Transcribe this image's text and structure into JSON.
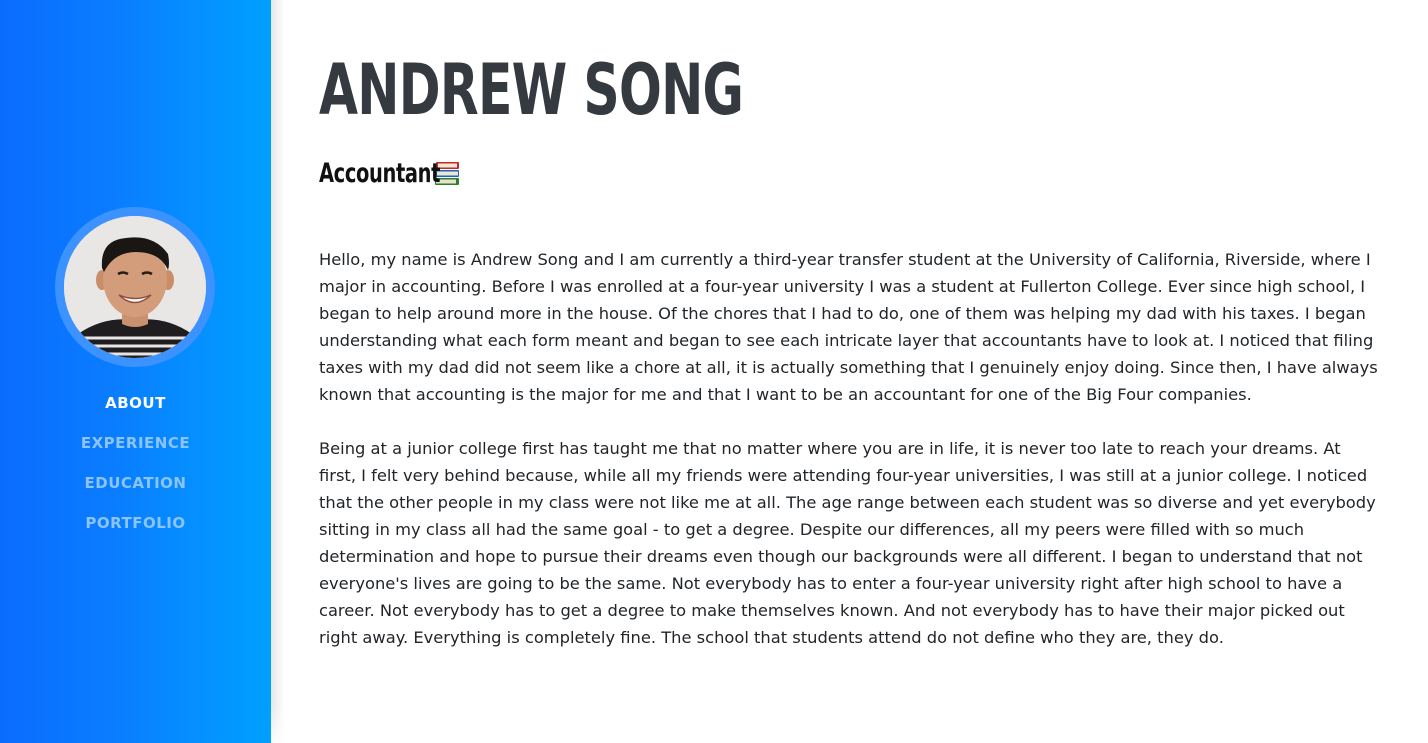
{
  "sidebar": {
    "nav": [
      {
        "label": "ABOUT",
        "active": true
      },
      {
        "label": "EXPERIENCE",
        "active": false
      },
      {
        "label": "EDUCATION",
        "active": false
      },
      {
        "label": "PORTFOLIO",
        "active": false
      }
    ],
    "colors": {
      "gradient_start": "#0a6cff",
      "gradient_end": "#00a0ff",
      "active": "#ffffff",
      "inactive": "#8cc4ff"
    }
  },
  "header": {
    "name": "ANDREW SONG",
    "subtitle": "Accountant",
    "subtitle_icon": "books-icon"
  },
  "about": {
    "paragraphs": [
      "Hello, my name is Andrew Song and I am currently a third-year transfer student at the University of California, Riverside, where I major in accounting. Before I was enrolled at a four-year university I was a student at Fullerton College. Ever since high school, I began to help around more in the house. Of the chores that I had to do, one of them was helping my dad with his taxes. I began understanding what each form meant and began to see each intricate layer that accountants have to look at. I noticed that filing taxes with my dad did not seem like a chore at all, it is actually something that I genuinely enjoy doing. Since then, I have always known that accounting is the major for me and that I want to be an accountant for one of the Big Four companies.",
      "Being at a junior college first has taught me that no matter where you are in life, it is never too late to reach your dreams. At first, I felt very behind because, while all my friends were attending four-year universities, I was still at a junior college. I noticed that the other people in my class were not like me at all. The age range between each student was so diverse and yet everybody sitting in my class all had the same goal - to get a degree. Despite our differences, all my peers were filled with so much determination and hope to pursue their dreams even though our backgrounds were all different. I began to understand that not everyone's lives are going to be the same. Not everybody has to enter a four-year university right after high school to have a career. Not everybody has to get a degree to make themselves known. And not everybody has to have their major picked out right away. Everything is completely fine. The school that students attend do not define who they are, they do."
    ]
  }
}
